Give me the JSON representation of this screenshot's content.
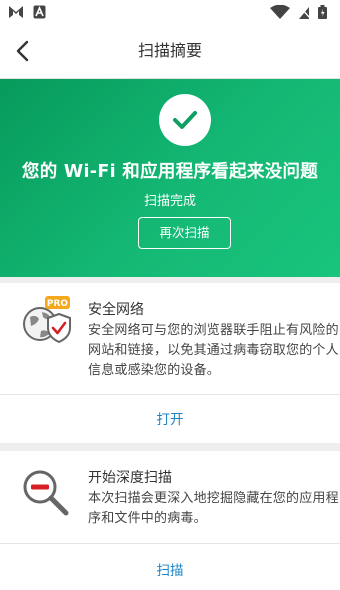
{
  "status_bar": {
    "icons": [
      "mcafee-logo-icon",
      "a-notification-icon",
      "wifi-icon",
      "no-sim-icon",
      "battery-icon"
    ]
  },
  "header": {
    "title": "扫描摘要",
    "back_icon": "chevron-left-icon"
  },
  "hero": {
    "icon": "checkmark-icon",
    "headline": "您的 Wi-Fi 和应用程序看起来没问题",
    "subtitle": "扫描完成",
    "button_label": "再次扫描",
    "colors": {
      "start": "#079a5c",
      "end": "#19c47d"
    }
  },
  "cards": [
    {
      "icon": "safe-browsing-globe-pro-icon",
      "badge": "PRO",
      "title": "安全网络",
      "description": "安全网络可与您的浏览器联手阻止有风险的网站和链接，以免其通过病毒窃取您的个人信息或感染您的设备。",
      "action_label": "打开"
    },
    {
      "icon": "deep-scan-magnifier-icon",
      "title": "开始深度扫描",
      "description": "本次扫描会更深入地挖掘隐藏在您的应用程序和文件中的病毒。",
      "action_label": "扫描"
    }
  ],
  "colors": {
    "accent_link": "#1e83c5",
    "page_bg": "#eeeeee"
  }
}
